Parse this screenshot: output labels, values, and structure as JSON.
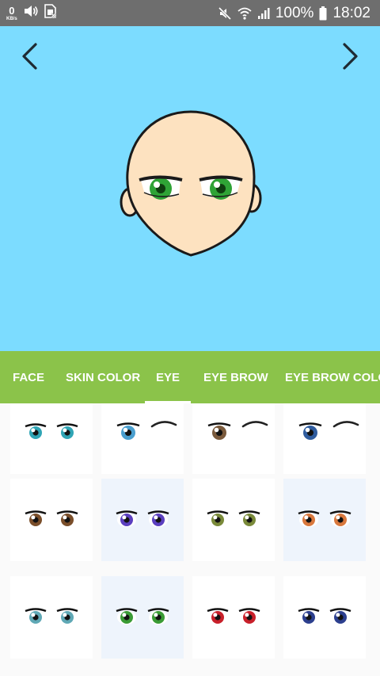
{
  "status_bar": {
    "net_speed_value": "0",
    "net_speed_unit": "KB/s",
    "battery_percent": "100%",
    "time": "18:02"
  },
  "preview": {
    "background_color": "#7cdcff",
    "prev_icon": "chevron-left-icon",
    "next_icon": "chevron-right-icon",
    "skin_color": "#fde2c0",
    "eye_color": "#2fa336"
  },
  "tabs": [
    {
      "label": "FACE",
      "active": false
    },
    {
      "label": "SKIN COLOR",
      "active": false
    },
    {
      "label": "EYE",
      "active": true
    },
    {
      "label": "EYE BROW",
      "active": false
    },
    {
      "label": "EYE BROW COLOR",
      "active": false
    }
  ],
  "tab_bar_color": "#8bc34a",
  "eye_options": [
    {
      "iris": "#2fa5b5",
      "brow": false
    },
    {
      "iris": "#4a9fcf",
      "brow": true
    },
    {
      "iris": "#7a5a3c",
      "brow": true
    },
    {
      "iris": "#2f5c9e",
      "brow": true
    },
    {
      "iris": "#7a4e2a",
      "brow": false
    },
    {
      "iris": "#5b3fbf",
      "brow": false
    },
    {
      "iris": "#7a8a3a",
      "brow": false
    },
    {
      "iris": "#d9783d",
      "brow": false
    },
    {
      "iris": "#5fa8b5",
      "brow": false
    },
    {
      "iris": "#3a9b35",
      "brow": false
    },
    {
      "iris": "#c8202a",
      "brow": false
    },
    {
      "iris": "#2c3f8e",
      "brow": false
    }
  ]
}
